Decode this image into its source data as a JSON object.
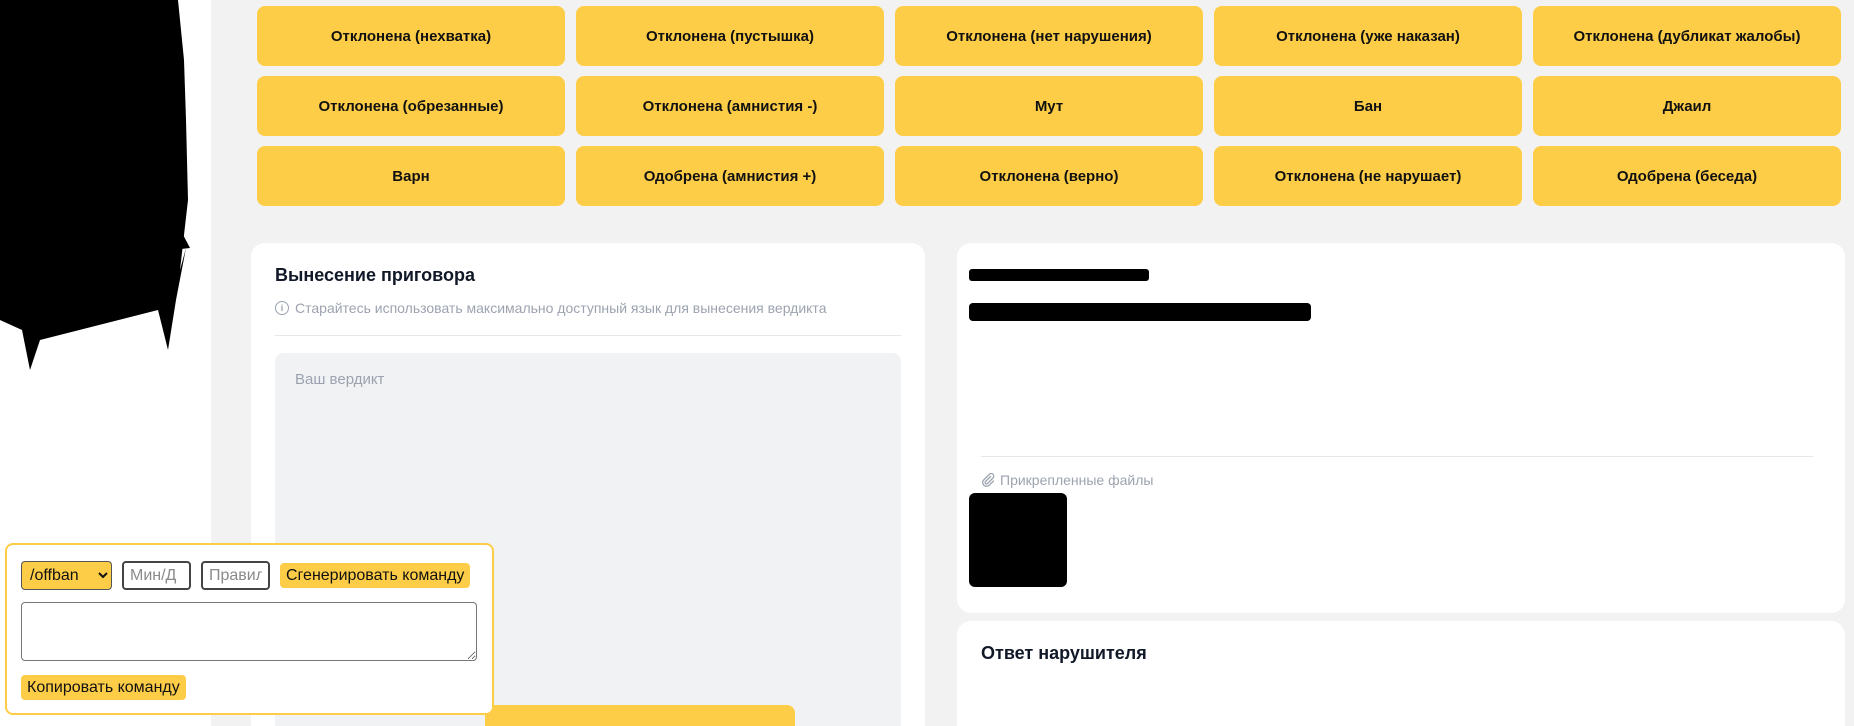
{
  "verdict_buttons": [
    "Отклонена (нехватка)",
    "Отклонена (пустышка)",
    "Отклонена (нет нарушения)",
    "Отклонена (уже наказан)",
    "Отклонена (дубликат жалобы)",
    "Отклонена (обрезанные)",
    "Отклонена (амнистия -)",
    "Мут",
    "Бан",
    "Джаил",
    "Варн",
    "Одобрена (амнистия +)",
    "Отклонена (верно)",
    "Отклонена (не нарушает)",
    "Одобрена (беседа)"
  ],
  "sentence_card": {
    "title": "Вынесение приговора",
    "hint": "Старайтесь использовать максимально доступный язык для вынесения вердикта",
    "verdict_placeholder": "Ваш вердикт"
  },
  "complaint_card": {
    "attached_files_label": "Прикрепленные файлы"
  },
  "answer_card": {
    "title": "Ответ нарушителя"
  },
  "command_panel": {
    "selected_command": "/offban",
    "minutes_placeholder": "Мин/Д",
    "rule_placeholder": "Правил",
    "generate_label": "Сгенерировать команду",
    "copy_label": "Копировать команду",
    "output_value": ""
  },
  "icons": {
    "hint_icon": "info-icon",
    "files_icon": "paperclip-icon"
  },
  "colors": {
    "accent": "#fecd47",
    "page_background": "#f2f2f3",
    "card_background": "#ffffff",
    "muted_text": "#9ca3af"
  }
}
